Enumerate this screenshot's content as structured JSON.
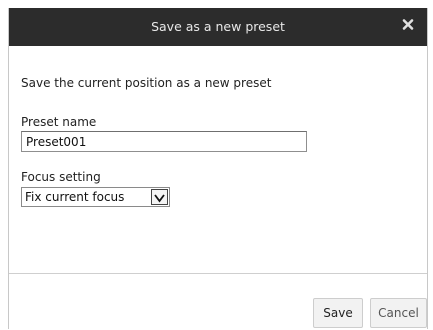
{
  "dialog": {
    "title": "Save as a new preset",
    "intro": "Save the current position as a new preset",
    "preset_name": {
      "label": "Preset name",
      "value": "Preset001"
    },
    "focus_setting": {
      "label": "Focus setting",
      "selected": "Fix current focus"
    },
    "buttons": {
      "save": "Save",
      "cancel": "Cancel"
    }
  },
  "icons": {
    "close": "close-icon",
    "dropdown": "chevron-down-icon"
  },
  "colors": {
    "titlebar": "#2c2c2c",
    "title_text": "#e8e8e8",
    "button_bg": "#f2f2f2"
  }
}
